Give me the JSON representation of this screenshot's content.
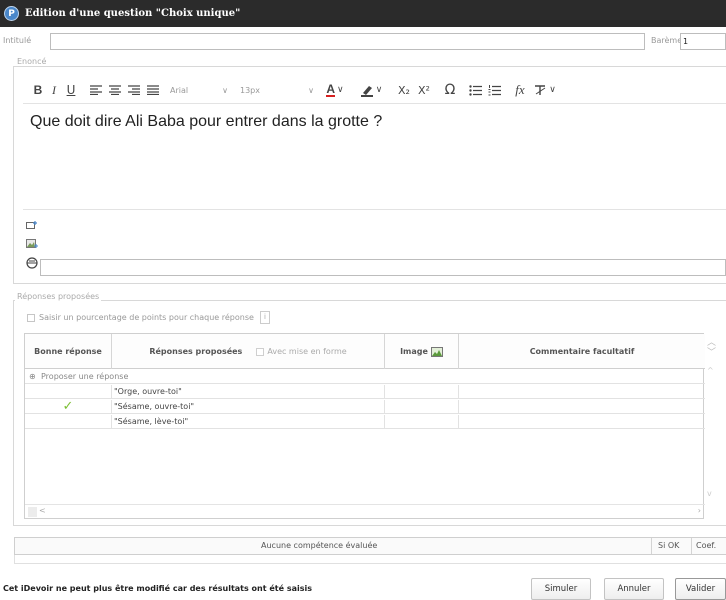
{
  "window": {
    "title": "Edition d'une question \"Choix unique\"",
    "app_icon": "pronote-app-icon"
  },
  "intitule": {
    "label": "Intitulé",
    "value": "",
    "bareme_label": "Barème",
    "bareme_value": "1"
  },
  "enonce": {
    "legend": "Enoncé",
    "toolbar": {
      "bold": "B",
      "italic": "I",
      "underline": "U",
      "font": "Arial",
      "size": "13px",
      "subscript": "X₂",
      "superscript": "X²",
      "omega": "Ω",
      "formula": "fx"
    },
    "text": "Que doit dire Ali Baba pour entrer dans la grotte ?",
    "link_value": ""
  },
  "reponses": {
    "legend": "Réponses proposées",
    "percentage_checkbox": {
      "label": "Saisir un pourcentage de points pour chaque réponse",
      "checked": false,
      "info": "i"
    },
    "columns": {
      "bonne": "Bonne réponse",
      "reponses": "Réponses proposées",
      "mise_en_forme": "Avec mise en forme",
      "image": "Image",
      "commentaire": "Commentaire facultatif"
    },
    "add_row_label": "Proposer une réponse",
    "rows": [
      {
        "bonne": "",
        "reponse": "\"Orge, ouvre-toi\"",
        "image": "",
        "commentaire": ""
      },
      {
        "bonne": "✓",
        "reponse": "\"Sésame, ouvre-toi\"",
        "image": "",
        "commentaire": ""
      },
      {
        "bonne": "",
        "reponse": "\"Sésame, lève-toi\"",
        "image": "",
        "commentaire": ""
      }
    ],
    "scroll_left": "<"
  },
  "competences": {
    "label": "Aucune compétence évaluée",
    "si_ok": "Si OK",
    "coef": "Coef."
  },
  "footer": {
    "message": "Cet iDevoir ne peut plus être modifié car des résultats ont été saisis",
    "simuler": "Simuler",
    "annuler": "Annuler",
    "valider": "Valider"
  },
  "colors": {
    "titlebar": "#2b2b2b",
    "check": "#7cbf33",
    "underline_red": "#d62020",
    "link_blue": "#4a87c9"
  }
}
